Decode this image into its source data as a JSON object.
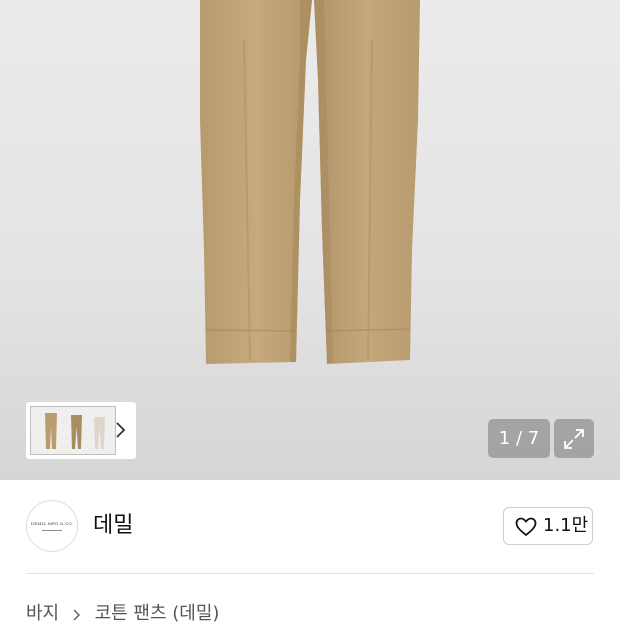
{
  "gallery": {
    "current": 1,
    "total": 7,
    "counter_text": "1 / 7",
    "image_icon": "khaki-pants-photo",
    "thumbnail_icon": "pants-thumbnail",
    "next_icon": "chevron-right-icon",
    "expand_icon": "expand-icon"
  },
  "brand": {
    "name": "데밀",
    "logo_text": "DEMIL MFG & CO.",
    "likes_label": "1.1만",
    "like_icon": "heart-icon"
  },
  "breadcrumb": {
    "items": [
      "바지",
      "코튼 팬츠 (데밀)"
    ],
    "separator_icon": "chevron-right-icon"
  },
  "colors": {
    "pants": "#c2a57a",
    "pants_shadow": "#a88a5f",
    "background": "#e8e8e8",
    "counter_bg": "#8a8a8a"
  }
}
